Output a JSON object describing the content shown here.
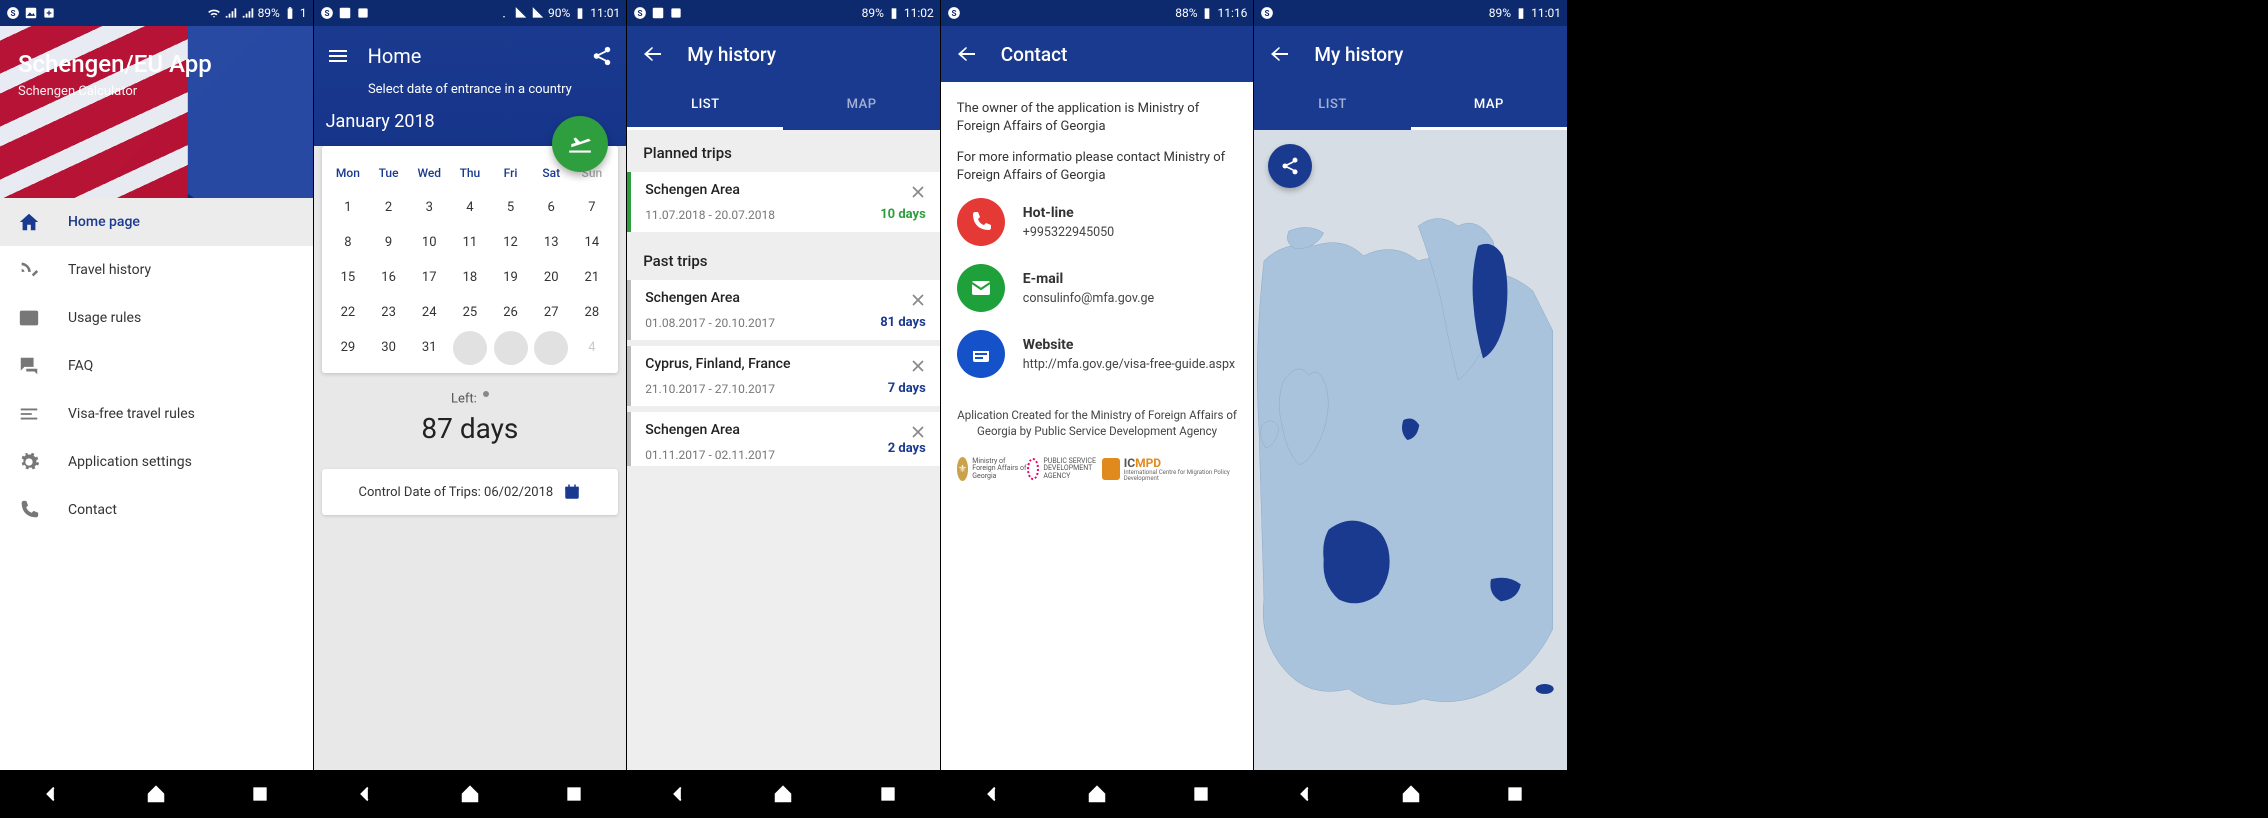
{
  "statusbar": {
    "battery_s1": "89%",
    "time_s1": "1",
    "battery_s2": "90%",
    "time_s2": "11:01",
    "battery_s3": "89%",
    "time_s3": "11:02",
    "battery_s4": "88%",
    "time_s4": "11:16",
    "battery_s5": "89%",
    "time_s5": "11:01"
  },
  "screen1": {
    "title": "Schengen/EU App",
    "subtitle": "Schengen Calculator",
    "menu": [
      {
        "icon": "home",
        "label": "Home page",
        "active": true
      },
      {
        "icon": "satellite",
        "label": "Travel history"
      },
      {
        "icon": "book",
        "label": "Usage rules"
      },
      {
        "icon": "forum",
        "label": "FAQ"
      },
      {
        "icon": "sort",
        "label": "Visa-free travel rules"
      },
      {
        "icon": "gear",
        "label": "Application settings"
      },
      {
        "icon": "phone",
        "label": "Contact"
      }
    ]
  },
  "screen2": {
    "title": "Home",
    "prompt": "Select date of entrance in a country",
    "month": "January 2018",
    "weekdays": [
      "Mon",
      "Tue",
      "Wed",
      "Thu",
      "Fri",
      "Sat",
      "Sun"
    ],
    "days_row1": [
      "1",
      "2",
      "3",
      "4",
      "5",
      "6",
      "7"
    ],
    "days_row2": [
      "8",
      "9",
      "10",
      "11",
      "12",
      "13",
      "14"
    ],
    "days_row3": [
      "15",
      "16",
      "17",
      "18",
      "19",
      "20",
      "21"
    ],
    "days_row4": [
      "22",
      "23",
      "24",
      "25",
      "26",
      "27",
      "28"
    ],
    "days_row5": [
      "29",
      "30",
      "31",
      "",
      "",
      "",
      "4"
    ],
    "left_label": "Left:",
    "left_value": "87 days",
    "control_date_label": "Control Date of Trips: 06/02/2018"
  },
  "screen3": {
    "title": "My history",
    "tabs": {
      "list": "LIST",
      "map": "MAP"
    },
    "section_planned": "Planned trips",
    "section_past": "Past trips",
    "planned": [
      {
        "title": "Schengen Area",
        "dates": "11.07.2018 - 20.07.2018",
        "days": "10 days"
      }
    ],
    "past": [
      {
        "title": "Schengen Area",
        "dates": "01.08.2017 - 20.10.2017",
        "days": "81 days"
      },
      {
        "title": "Cyprus, Finland, France",
        "dates": "21.10.2017 - 27.10.2017",
        "days": "7 days"
      },
      {
        "title": "Schengen Area",
        "dates": "01.11.2017 - 02.11.2017",
        "days": "2 days"
      }
    ]
  },
  "screen4": {
    "title": "Contact",
    "para1": "The owner of the application is Ministry of Foreign Affairs of Georgia",
    "para2": "For more informatio please contact Ministry of Foreign Affairs of Georgia",
    "hotline_label": "Hot-line",
    "hotline_value": "+995322945050",
    "email_label": "E-mail",
    "email_value": "consulinfo@mfa.gov.ge",
    "website_label": "Website",
    "website_value": "http://mfa.gov.ge/visa-free-guide.aspx",
    "credits": "Aplication Created for the Ministry of Foreign Affairs of Georgia by Public Service Development Agency",
    "logo1": "Ministry of Foreign Affairs of Georgia",
    "logo2": "PUBLIC SERVICE DEVELOPMENT AGENCY",
    "logo3a": "IC",
    "logo3b": "MPD",
    "logo3sub": "International Centre for Migration Policy Development"
  },
  "screen5": {
    "title": "My history",
    "tabs": {
      "list": "LIST",
      "map": "MAP"
    }
  }
}
